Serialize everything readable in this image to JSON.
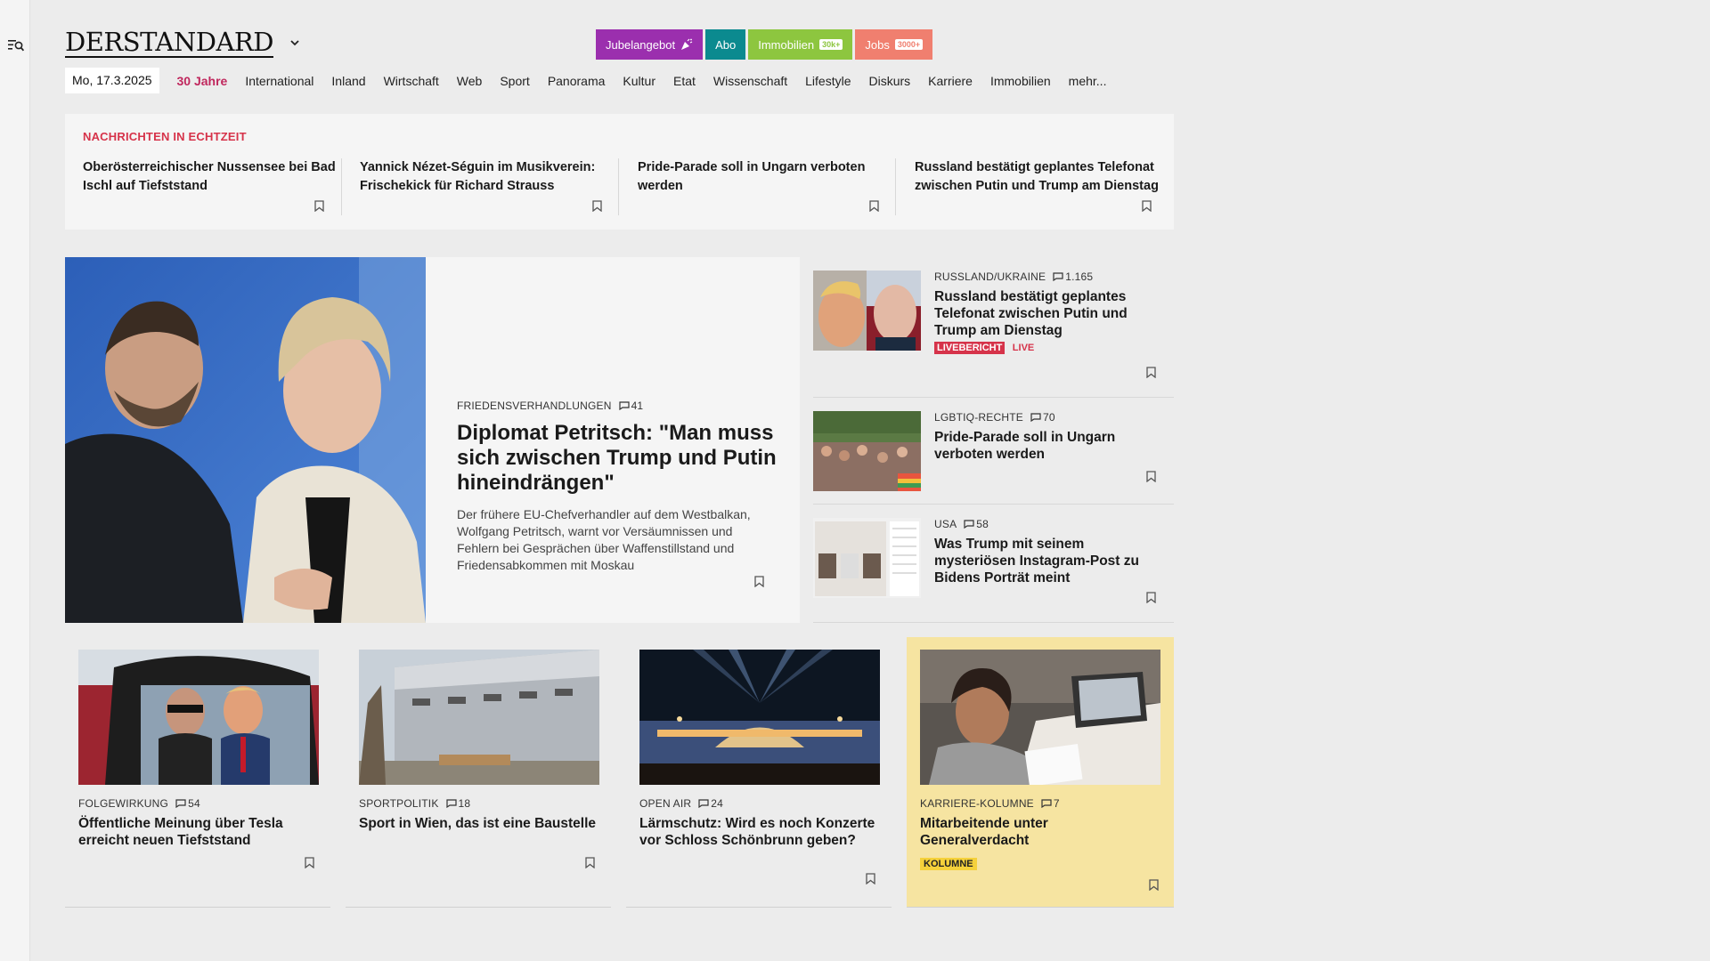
{
  "header": {
    "logo": "DERSTANDARD",
    "promo": [
      {
        "label": "Jubelangebot",
        "badge": ""
      },
      {
        "label": "Abo",
        "badge": ""
      },
      {
        "label": "Immobilien",
        "badge": "30k+"
      },
      {
        "label": "Jobs",
        "badge": "3000+"
      }
    ]
  },
  "nav": {
    "date": "Mo, 17.3.2025",
    "items": [
      "30 Jahre",
      "International",
      "Inland",
      "Wirtschaft",
      "Web",
      "Sport",
      "Panorama",
      "Kultur",
      "Etat",
      "Wissenschaft",
      "Lifestyle",
      "Diskurs",
      "Karriere",
      "Immobilien",
      "mehr..."
    ]
  },
  "ticker": {
    "title": "NACHRICHTEN IN ECHTZEIT",
    "items": [
      "Oberösterreichischer Nussensee bei Bad Ischl auf Tiefststand",
      "Yannick Nézet-Séguin im Musikverein: Frischekick für Richard Strauss",
      "Pride-Parade soll in Ungarn verboten werden",
      "Russland bestätigt geplantes Telefonat zwischen Putin und Trump am Dienstag"
    ]
  },
  "lead": {
    "kicker": "FRIEDENSVERHANDLUNGEN",
    "comments": "41",
    "title": "Diplomat Petritsch: \"Man muss sich zwischen Trump und Putin hineindrängen\"",
    "teaser": "Der frühere EU-Chefverhandler auf dem Westbalkan, Wolfgang Petritsch, warnt vor Versäumnissen und Fehlern bei Gesprächen über Waffenstillstand und Friedensabkommen mit Moskau"
  },
  "side": [
    {
      "kicker": "RUSSLAND/UKRAINE",
      "comments": "1.165",
      "title": "Russland bestätigt geplantes Telefonat zwischen Putin und Trump am Dienstag",
      "tag": "LIVEBERICHT",
      "live": "LIVE"
    },
    {
      "kicker": "LGBTIQ-RECHTE",
      "comments": "70",
      "title": "Pride-Parade soll in Ungarn verboten werden"
    },
    {
      "kicker": "USA",
      "comments": "58",
      "title": "Was Trump mit seinem mysteriösen Instagram-Post zu Bidens Porträt meint"
    }
  ],
  "cards": [
    {
      "kicker": "FOLGEWIRKUNG",
      "comments": "54",
      "title": "Öffentliche Meinung über Tesla erreicht neuen Tiefststand"
    },
    {
      "kicker": "SPORTPOLITIK",
      "comments": "18",
      "title": "Sport in Wien, das ist eine Baustelle"
    },
    {
      "kicker": "OPEN AIR",
      "comments": "24",
      "title": "Lärmschutz: Wird es noch Konzerte vor Schloss Schönbrunn geben?"
    },
    {
      "kicker": "KARRIERE-KOLUMNE",
      "comments": "7",
      "title": "Mitarbeitende unter Generalverdacht",
      "tag": "KOLUMNE"
    }
  ],
  "colors": {
    "accent_red": "#d6334a",
    "jubel": "#9b2fae",
    "abo": "#0b8a8f",
    "immo": "#8dc63f",
    "jobs": "#f07f6f",
    "kolumne_bg": "#f6e4a1"
  }
}
